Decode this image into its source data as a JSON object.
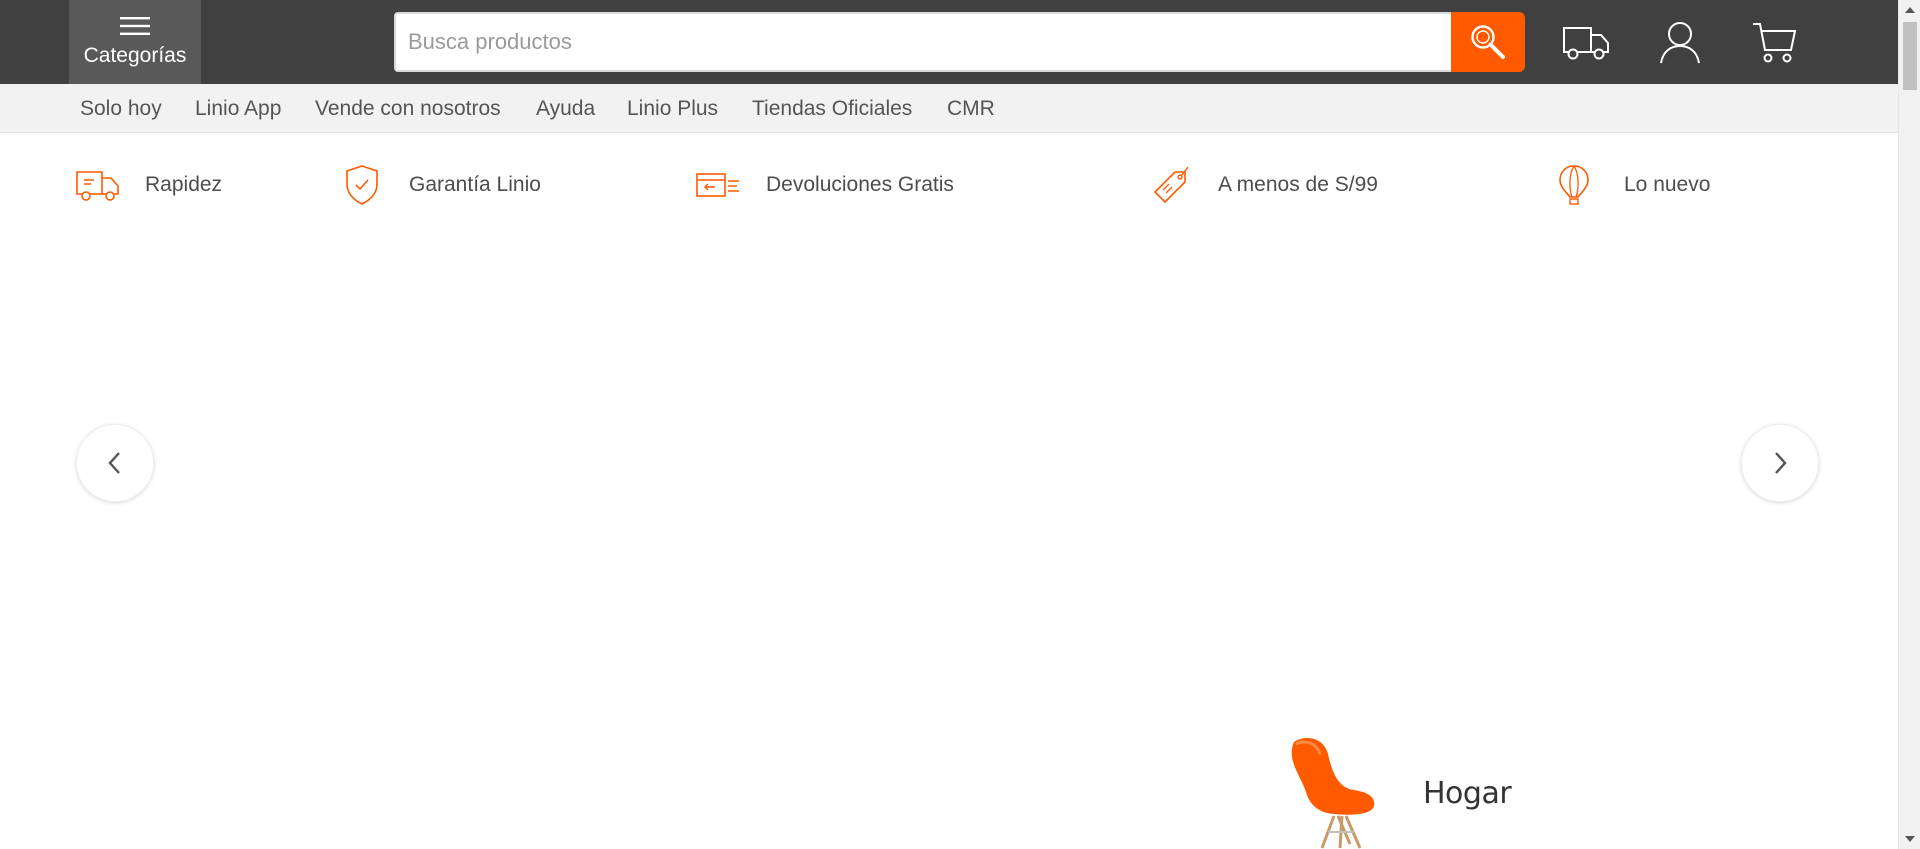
{
  "header": {
    "categories_label": "Categorías",
    "search_placeholder": "Busca productos",
    "search_value": ""
  },
  "nav": {
    "links": [
      "Solo hoy",
      "Linio App",
      "Vende con nosotros",
      "Ayuda",
      "Linio Plus",
      "Tiendas Oficiales",
      "CMR"
    ]
  },
  "features": [
    {
      "label": "Rapidez",
      "icon": "truck-icon"
    },
    {
      "label": "Garantía Linio",
      "icon": "shield-check-icon"
    },
    {
      "label": "Devoluciones Gratis",
      "icon": "return-box-icon"
    },
    {
      "label": "A menos de S/99",
      "icon": "price-tag-icon"
    },
    {
      "label": "Lo nuevo",
      "icon": "balloon-icon"
    }
  ],
  "banner": {
    "category_label": "Hogar",
    "category_icon": "chair-icon"
  },
  "colors": {
    "accent": "#ff5a00",
    "header_bg": "#404040",
    "nav_bg": "#f2f2f2"
  }
}
